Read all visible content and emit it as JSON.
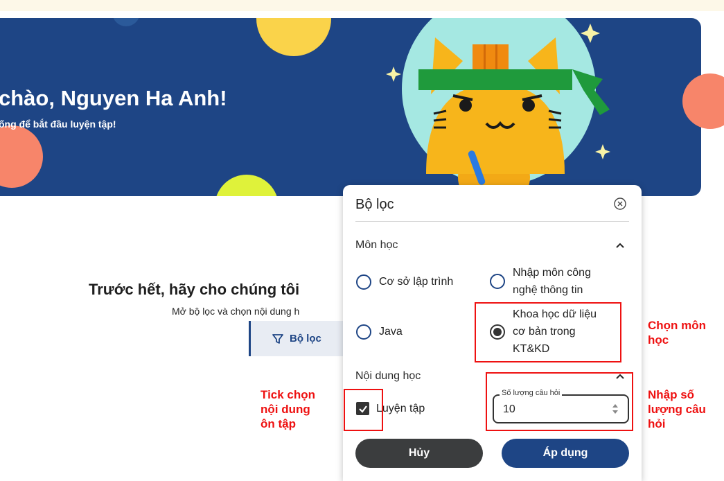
{
  "hero": {
    "greeting": "chào, Nguyen Ha Anh!",
    "subtitle": "ống để bắt đầu luyện tập!"
  },
  "main": {
    "heading": "Trước hết, hãy cho chúng tôi",
    "subtext": "Mở bộ lọc và chọn nội dung h",
    "filter_button_label": "Bộ lọc"
  },
  "filter_panel": {
    "title": "Bộ lọc",
    "subject_section_label": "Môn học",
    "subjects": [
      {
        "label": "Cơ sở lập trình",
        "selected": false
      },
      {
        "label_line1": "Nhập môn công",
        "label_line2": "nghệ thông tin",
        "selected": false
      },
      {
        "label": "Java",
        "selected": false
      },
      {
        "label_line1": "Khoa học dữ liệu",
        "label_line2": "cơ bản trong",
        "label_line3": "KT&KD",
        "selected": true
      }
    ],
    "content_section_label": "Nội dung học",
    "practice_checkbox_label": "Luyện tập",
    "practice_checked": true,
    "question_count_label": "Số lượng câu hỏi",
    "question_count_value": "10",
    "cancel_label": "Hủy",
    "apply_label": "Áp dụng"
  },
  "annotations": {
    "choose_subject_line1": "Chọn môn",
    "choose_subject_line2": "học",
    "tick_content_line1": "Tick chọn",
    "tick_content_line2": "nội dung",
    "tick_content_line3": "ôn tập",
    "enter_count_line1": "Nhập số",
    "enter_count_line2": "lượng câu",
    "enter_count_line3": "hỏi"
  },
  "colors": {
    "hero_bg": "#1e4585",
    "primary": "#1e4585",
    "annotation": "#ee1111"
  }
}
